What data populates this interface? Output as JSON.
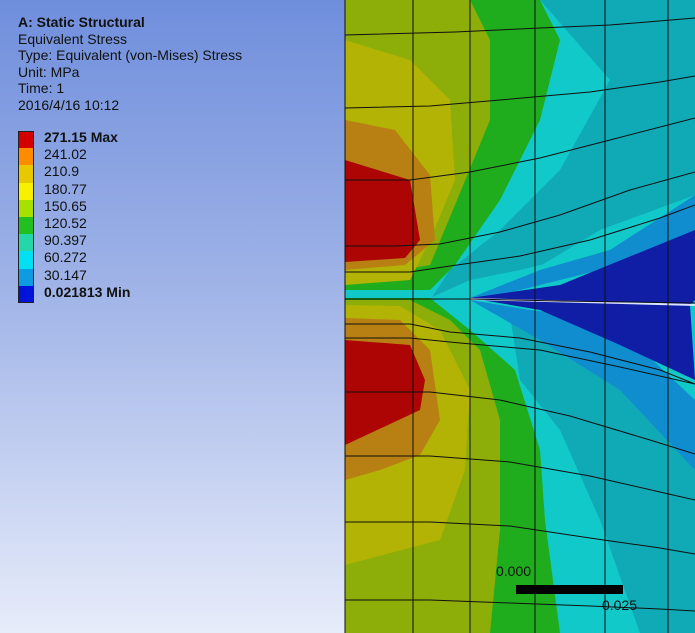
{
  "info": {
    "title": "A: Static Structural",
    "result": "Equivalent Stress",
    "type": "Type: Equivalent (von-Mises) Stress",
    "unit": "Unit: MPa",
    "time": "Time: 1",
    "date": "2016/4/16 10:12"
  },
  "legend": {
    "entries": [
      {
        "label": "271.15 Max",
        "color": "#d40000",
        "bold": true
      },
      {
        "label": "241.02",
        "color": "#ff8c00",
        "bold": false
      },
      {
        "label": "210.9",
        "color": "#e8c800",
        "bold": false
      },
      {
        "label": "180.77",
        "color": "#f7f000",
        "bold": false
      },
      {
        "label": "150.65",
        "color": "#a8e000",
        "bold": false
      },
      {
        "label": "120.52",
        "color": "#22bf20",
        "bold": false
      },
      {
        "label": "90.397",
        "color": "#25d7a8",
        "bold": false
      },
      {
        "label": "60.272",
        "color": "#00e0f2",
        "bold": false
      },
      {
        "label": "30.147",
        "color": "#0f9be2",
        "bold": false
      },
      {
        "label": "0.021813 Min",
        "color": "#0014d9",
        "bold": true
      }
    ]
  },
  "scale_bar": {
    "start_label": "0.000",
    "end_label": "0.025"
  },
  "colors": {
    "max_red": "#ad0404",
    "dark_orange": "#b97a12",
    "olive": "#a9ad06",
    "light_olive": "#8dad08",
    "green": "#1fb11b",
    "teal_green": "#10a890",
    "cyan": "#11c9c9",
    "light_blue": "#118ecf",
    "deep_blue": "#0f1ea5",
    "mesh_line": "#101010"
  }
}
